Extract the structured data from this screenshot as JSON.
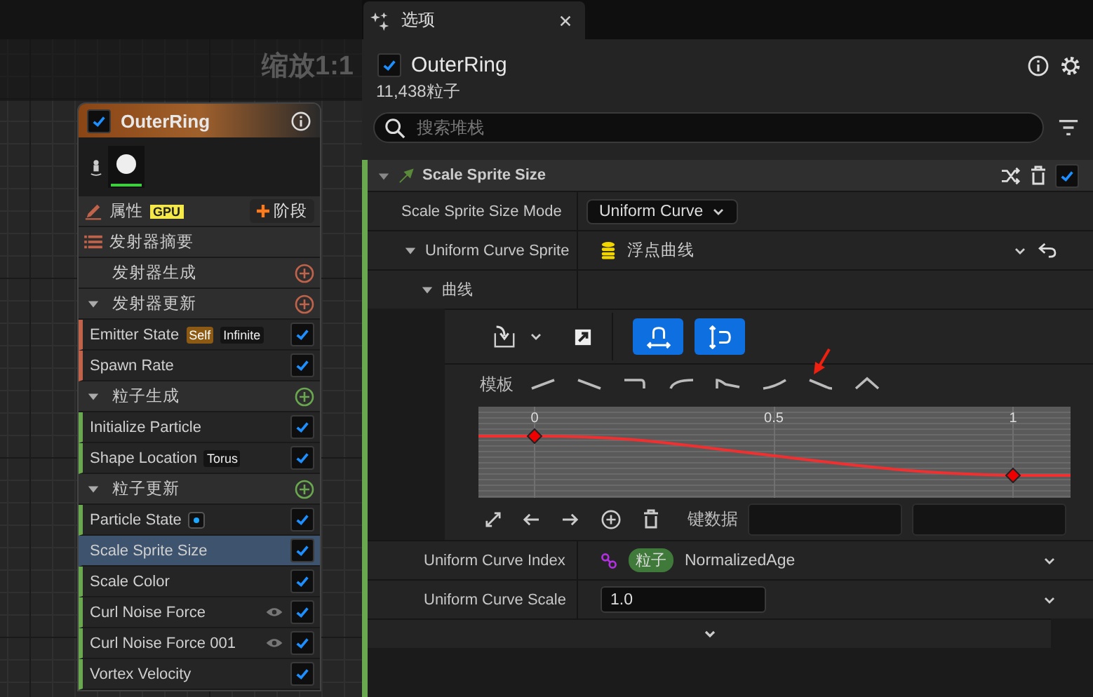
{
  "graph": {
    "zoom_label": "缩放1:1"
  },
  "node": {
    "title": "OuterRing",
    "checked": true,
    "properties_label": "属性",
    "sim_badge": "GPU",
    "stage_button": "阶段",
    "summary_label": "发射器摘要",
    "stages": [
      {
        "label": "发射器生成",
        "color": "#c0634a",
        "expanded": false
      },
      {
        "label": "发射器更新",
        "color": "#c0634a",
        "expanded": true,
        "modules": [
          {
            "name": "Emitter State",
            "tags": [
              {
                "kind": "scope",
                "text": "Self"
              },
              {
                "kind": "value",
                "text": "Infinite"
              }
            ],
            "checked": true,
            "selected": false
          },
          {
            "name": "Spawn Rate",
            "checked": true,
            "selected": false
          }
        ]
      },
      {
        "label": "粒子生成",
        "color": "#6aa84f",
        "expanded": true,
        "modules": [
          {
            "name": "Initialize Particle",
            "checked": true,
            "selected": false
          },
          {
            "name": "Shape Location",
            "tags": [
              {
                "kind": "value",
                "text": "Torus"
              }
            ],
            "checked": true,
            "selected": false
          }
        ]
      },
      {
        "label": "粒子更新",
        "color": "#6aa84f",
        "expanded": true,
        "modules": [
          {
            "name": "Particle State",
            "dot_badge": true,
            "checked": true,
            "selected": false
          },
          {
            "name": "Scale Sprite Size",
            "checked": true,
            "selected": true
          },
          {
            "name": "Scale Color",
            "checked": true,
            "selected": false
          },
          {
            "name": "Curl Noise Force",
            "visible_toggle": true,
            "checked": true,
            "selected": false
          },
          {
            "name": "Curl Noise Force 001",
            "visible_toggle": true,
            "checked": true,
            "selected": false
          },
          {
            "name": "Vortex Velocity",
            "checked": true,
            "selected": false
          }
        ]
      }
    ]
  },
  "panel": {
    "tab": "选项",
    "emitter": {
      "name": "OuterRing",
      "checked": true,
      "count": "11,438粒子"
    },
    "search": {
      "placeholder": "搜索堆栈"
    },
    "module": {
      "title": "Scale Sprite Size",
      "checked": true,
      "color": "#6aa84f",
      "properties": [
        {
          "kind": "dropdown",
          "label": "Scale Sprite Size Mode",
          "value": "Uniform Curve"
        },
        {
          "kind": "asset",
          "label": "Uniform Curve Sprite",
          "expanded": true,
          "value": "浮点曲线"
        },
        {
          "kind": "group",
          "label": "曲线",
          "expanded": true
        },
        {
          "kind": "curve",
          "templates_label": "模板",
          "x_labels": [
            "0",
            "0.5",
            "1"
          ],
          "key_label": "键数据",
          "toggles": [
            {
              "on": true
            },
            {
              "on": true
            }
          ]
        },
        {
          "kind": "binding",
          "label": "Uniform Curve Index",
          "namespace": "粒子",
          "value": "NormalizedAge"
        },
        {
          "kind": "number",
          "label": "Uniform Curve Scale",
          "value": "1.0"
        }
      ]
    }
  }
}
